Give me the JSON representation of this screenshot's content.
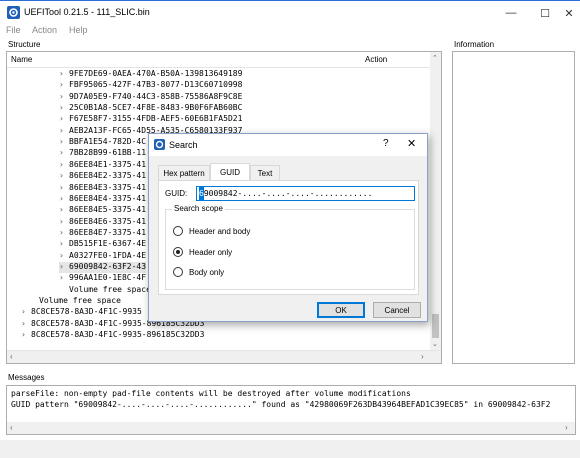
{
  "window": {
    "title": "UEFITool 0.21.5 - 111_SLIC.bin",
    "icon": "gear-icon",
    "minimize": "—",
    "maximize": "☐",
    "close": "✕"
  },
  "menu": [
    "File",
    "Action",
    "Help"
  ],
  "structure": {
    "label": "Structure",
    "columns": {
      "name": "Name",
      "action": "Action"
    },
    "rows": [
      "9FE7DE69-0AEA-470A-B50A-139813649189",
      "FBF95065-427F-47B3-8077-D13C60710998",
      "9D7A05E9-F740-44C3-858B-75586A8F9C8E",
      "25C0B1A8-5CE7-4F8E-8483-9B0F6FAB60BC",
      "F67E58F7-3155-4FDB-AEF5-60E6B1FA5D21",
      "AEB2A13F-FC65-4D55-A535-C6580133F937",
      "BBFA1E54-782D-4C",
      "7BB28B99-61BB-11",
      "86EE84E1-3375-41",
      "86EE84E2-3375-41",
      "86EE84E3-3375-41",
      "86EE84E4-3375-41",
      "86EE84E5-3375-41",
      "86EE84E6-3375-41",
      "86EE84E7-3375-41",
      "DB515F1E-6367-4E",
      "A0327FE0-1FDA-4E",
      "69009842-63F2-43",
      "996AA1E0-1E8C-4F"
    ],
    "free_inner": "Volume free space",
    "free_outer": "Volume free space",
    "volumes": [
      "8C8CE578-8A3D-4F1C-9935",
      "8C8CE578-8A3D-4F1C-9935-896185C32DD3",
      "8C8CE578-8A3D-4F1C-9935-896185C32DD3"
    ]
  },
  "information": {
    "label": "Information"
  },
  "messages": {
    "label": "Messages",
    "lines": [
      "parseFile: non-empty pad-file contents will be destroyed after volume modifications",
      "GUID pattern \"69009842-....-....-....-............\" found as \"42980069F263DB43964BEFAD1C39EC85\" in 69009842-63F2"
    ]
  },
  "dialog": {
    "title": "Search",
    "help": "?",
    "close": "✕",
    "tabs": [
      "Hex pattern",
      "GUID",
      "Text"
    ],
    "active_tab": "GUID",
    "guid_label": "GUID:",
    "guid_first_char": "6",
    "guid_value_rest": "9009842-....-....-....-............",
    "scope_label": "Search scope",
    "options": [
      "Header and body",
      "Header only",
      "Body only"
    ],
    "selected_option": "Header only",
    "ok": "OK",
    "cancel": "Cancel"
  },
  "colors": {
    "accent": "#0078d7",
    "window_bg": "#f0f0f0"
  }
}
